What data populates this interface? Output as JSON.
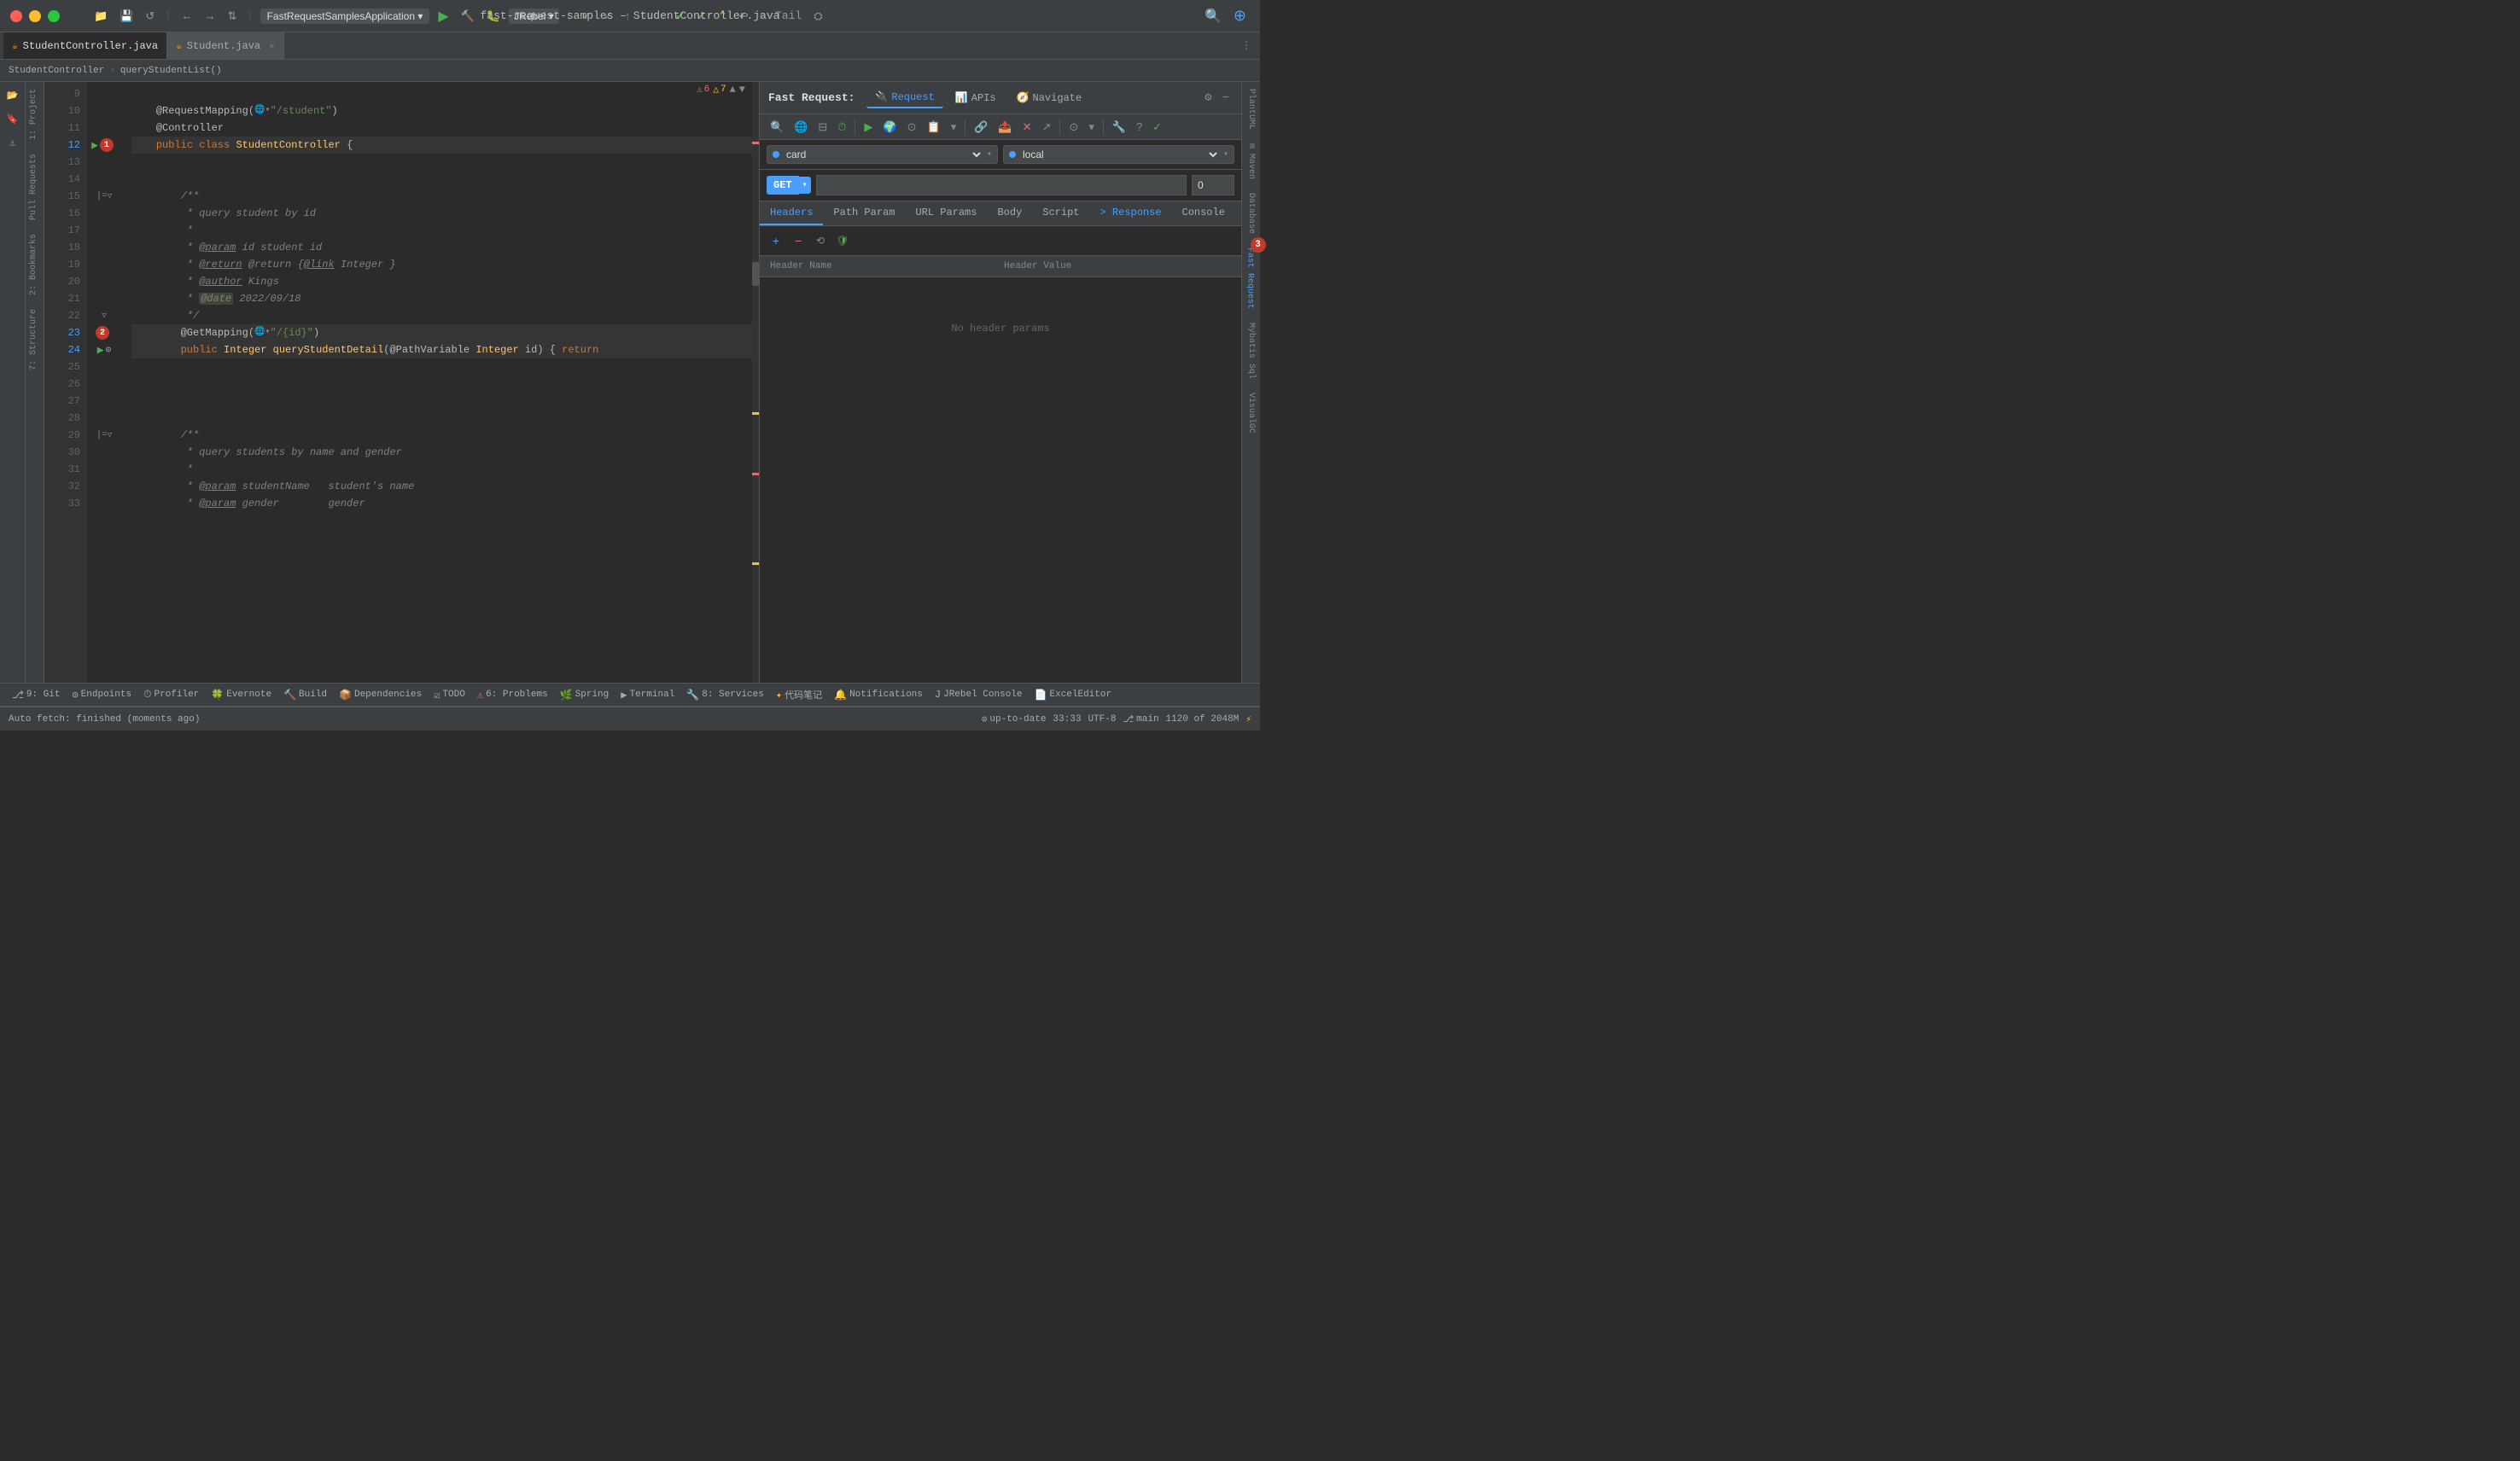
{
  "window": {
    "title": "fast-request-samples – StudentController.java"
  },
  "titlebar": {
    "project_dropdown": "FastRequestSamplesApplication",
    "git_label": "Git:",
    "tail_label": "Tail"
  },
  "tabs": [
    {
      "label": "StudentController.java",
      "icon": "☕",
      "active": true,
      "closable": false
    },
    {
      "label": "Student.java",
      "icon": "☕",
      "active": false,
      "closable": true
    }
  ],
  "breadcrumb": {
    "class": "StudentController",
    "method": "queryStudentList()"
  },
  "code": {
    "lines": [
      {
        "num": 9,
        "content": ""
      },
      {
        "num": 10,
        "content": "    @RequestMapping(🌐\"/student\")",
        "has_fold": false
      },
      {
        "num": 11,
        "content": "    @Controller",
        "has_fold": false
      },
      {
        "num": 12,
        "content": "    public class StudentController {",
        "badge": "1",
        "has_run": true
      },
      {
        "num": 13,
        "content": ""
      },
      {
        "num": 14,
        "content": ""
      },
      {
        "num": 15,
        "content": "        /**",
        "has_fold": true
      },
      {
        "num": 16,
        "content": "         * query student by id"
      },
      {
        "num": 17,
        "content": "         *"
      },
      {
        "num": 18,
        "content": "         * @param id student id"
      },
      {
        "num": 19,
        "content": "         * @return @return {@link Integer }"
      },
      {
        "num": 20,
        "content": "         * @author Kings"
      },
      {
        "num": 21,
        "content": "         * @date 2022/09/18"
      },
      {
        "num": 22,
        "content": "         */",
        "has_fold": true
      },
      {
        "num": 23,
        "content": "        @GetMapping(🌐\"/{id}\")",
        "badge": "2"
      },
      {
        "num": 24,
        "content": "        public Integer queryStudentDetail(@PathVariable Integer id) { return",
        "has_run": true,
        "has_run2": true
      },
      {
        "num": 25,
        "content": ""
      },
      {
        "num": 26,
        "content": ""
      },
      {
        "num": 27,
        "content": ""
      },
      {
        "num": 28,
        "content": ""
      },
      {
        "num": 29,
        "content": "        /**",
        "has_fold": true
      },
      {
        "num": 30,
        "content": "         * query students by name and gender"
      },
      {
        "num": 31,
        "content": "         *"
      },
      {
        "num": 32,
        "content": "         * @param studentName   student's name"
      },
      {
        "num": 33,
        "content": "         * @param gender        gender"
      }
    ]
  },
  "right_panel": {
    "title": "Fast Request:",
    "tabs": [
      {
        "label": "Request",
        "icon": "🔌",
        "active": true
      },
      {
        "label": "APIs",
        "icon": "📊",
        "active": false
      },
      {
        "label": "Navigate",
        "icon": "🧭",
        "active": false
      }
    ],
    "method": "GET",
    "url_placeholder": "",
    "timeout": "0",
    "env1": "card",
    "env2": "local",
    "request_tabs": [
      {
        "label": "Headers",
        "active": true
      },
      {
        "label": "Path Param",
        "active": false
      },
      {
        "label": "URL Params",
        "active": false
      },
      {
        "label": "Body",
        "active": false
      },
      {
        "label": "Script",
        "active": false
      },
      {
        "label": "> Response",
        "active": false,
        "special": true
      },
      {
        "label": "Console",
        "active": false
      }
    ],
    "header_columns": [
      "Header Name",
      "Header Value"
    ],
    "no_params_text": "No header params",
    "settings_icon": "⚙",
    "minus_icon": "−"
  },
  "bottom_toolbar": {
    "items": [
      {
        "icon": "⎇",
        "label": "9: Git"
      },
      {
        "icon": "⊙",
        "label": "Endpoints"
      },
      {
        "icon": "⏱",
        "label": "Profiler"
      },
      {
        "icon": "🍀",
        "label": "Evernote"
      },
      {
        "icon": "🔨",
        "label": "Build"
      },
      {
        "icon": "📦",
        "label": "Dependencies"
      },
      {
        "icon": "☑",
        "label": "TODO"
      },
      {
        "icon": "⚠",
        "label": "6: Problems"
      },
      {
        "icon": "🌿",
        "label": "Spring"
      },
      {
        "icon": "▶",
        "label": "Terminal"
      },
      {
        "icon": "🔧",
        "label": "8: Services"
      },
      {
        "icon": "✦",
        "label": "代码笔记"
      },
      {
        "icon": "🔔",
        "label": "Notifications"
      },
      {
        "icon": "J",
        "label": "JRebel Console"
      },
      {
        "icon": "📄",
        "label": "ExcelEditor"
      }
    ]
  },
  "status_bar": {
    "autofetch": "Auto fetch: finished (moments ago)",
    "git_branch": "main",
    "errors": "6",
    "warnings": "7",
    "encoding": "UTF-8",
    "line_col": "33:33",
    "memory": "1120 of 2048M",
    "position": "up-to-date"
  },
  "side_labels": {
    "left": [
      "1: Project",
      "Pull Requests",
      "2: Bookmarks",
      "7: Structure"
    ],
    "right": [
      "PlantUML",
      "m Maven",
      "Database",
      "Fast Request",
      "Mybatis Sql",
      "VisualGC"
    ]
  },
  "errors_display": {
    "count_red": "6",
    "count_yellow": "7"
  }
}
